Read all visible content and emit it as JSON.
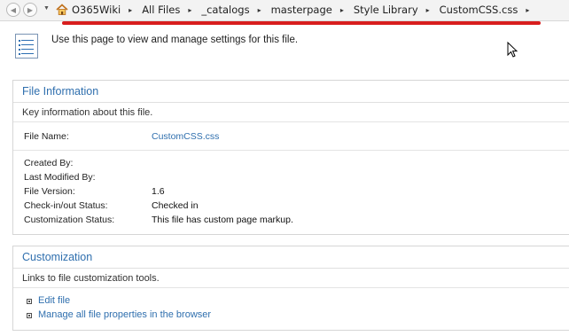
{
  "breadcrumb": {
    "items": [
      "O365Wiki",
      "All Files",
      "_catalogs",
      "masterpage",
      "Style Library",
      "CustomCSS.css"
    ],
    "separator": "▸"
  },
  "intro": {
    "text": "Use this page to view and manage settings for this file."
  },
  "file_information": {
    "title": "File Information",
    "description": "Key information about this file.",
    "fields": [
      {
        "label": "File Name:",
        "value": "CustomCSS.css"
      },
      {
        "label": "Created By:",
        "value": ""
      },
      {
        "label": "Last Modified By:",
        "value": ""
      },
      {
        "label": "File Version:",
        "value": "1.6"
      },
      {
        "label": "Check-in/out Status:",
        "value": "Checked in"
      },
      {
        "label": "Customization Status:",
        "value": "This file has custom page markup."
      }
    ]
  },
  "customization": {
    "title": "Customization",
    "description": "Links to file customization tools.",
    "links": [
      "Edit file",
      "Manage all file properties in the browser"
    ]
  },
  "colors": {
    "link": "#2f6fae",
    "annotation": "#d81d1d"
  },
  "icons": [
    "back-icon",
    "forward-icon",
    "dropdown-icon",
    "home-icon",
    "page-settings-icon",
    "mouse-cursor-icon",
    "bullet-icon"
  ]
}
